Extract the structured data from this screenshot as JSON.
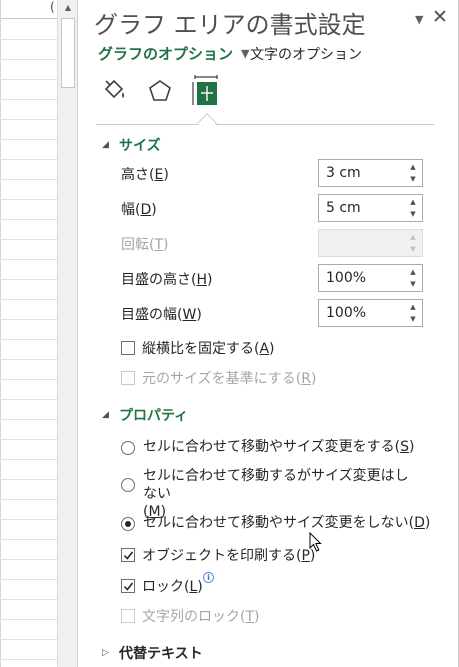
{
  "pane": {
    "title": "グラフ エリアの書式設定",
    "menu_icon": "chevron-down-icon",
    "close_label": "✕"
  },
  "tabs": {
    "graph_options": "グラフのオプション",
    "text_options": "文字のオプション"
  },
  "icons": [
    "paint-bucket-icon",
    "pentagon-icon",
    "size-properties-icon"
  ],
  "size_section": {
    "title": "サイズ",
    "height": {
      "label": "高さ",
      "key": "E",
      "value": "3 cm"
    },
    "width": {
      "label": "幅",
      "key": "D",
      "value": "5 cm"
    },
    "rotation": {
      "label": "回転",
      "key": "T",
      "value": ""
    },
    "scale_height": {
      "label": "目盛の高さ",
      "key": "H",
      "value": "100%"
    },
    "scale_width": {
      "label": "目盛の幅",
      "key": "W",
      "value": "100%"
    },
    "lock_aspect": {
      "label": "縦横比を固定する",
      "key": "A",
      "checked": false
    },
    "relative_original": {
      "label": "元のサイズを基準にする",
      "key": "R",
      "checked": false
    }
  },
  "properties_section": {
    "title": "プロパティ",
    "radio_move_size": {
      "label": "セルに合わせて移動やサイズ変更をする",
      "key": "S",
      "selected": false
    },
    "radio_move_nosize": {
      "label": "セルに合わせて移動するがサイズ変更はしない",
      "key": "M",
      "selected": false
    },
    "radio_nomove": {
      "label": "セルに合わせて移動やサイズ変更をしない",
      "key": "D",
      "selected": true
    },
    "print_object": {
      "label": "オブジェクトを印刷する",
      "key": "P",
      "checked": true
    },
    "locked": {
      "label": "ロック",
      "key": "L",
      "checked": true
    },
    "lock_text": {
      "label": "文字列のロック",
      "key": "T",
      "checked": false
    }
  },
  "alt_text_section": {
    "title": "代替テキスト"
  },
  "sheet": {
    "header_fragment": "("
  },
  "colors": {
    "accent": "#217346",
    "text": "#262626",
    "disabled": "#a6a6a6"
  }
}
